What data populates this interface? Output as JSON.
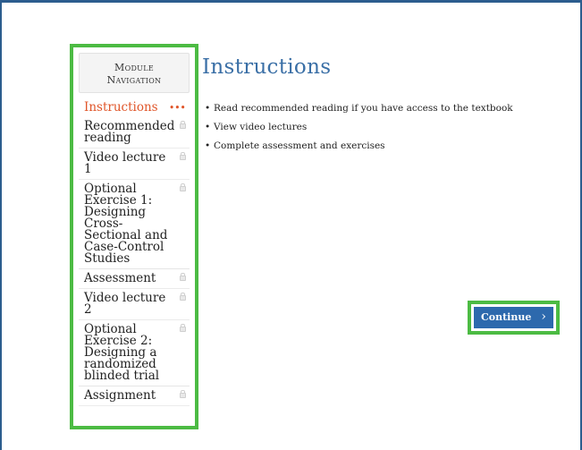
{
  "sidebar": {
    "header_line1": "Module",
    "header_line2": "Navigation",
    "items": [
      {
        "label": "Instructions",
        "active": true,
        "status": "•••"
      },
      {
        "label": "Recommended reading"
      },
      {
        "label": "Video lecture 1"
      },
      {
        "label": "Optional Exercise 1: Designing Cross-Sectional and Case-Control Studies"
      },
      {
        "label": "Assessment"
      },
      {
        "label": "Video lecture 2"
      },
      {
        "label": "Optional Exercise 2: Designing a randomized blinded trial"
      },
      {
        "label": "Assignment"
      }
    ]
  },
  "main": {
    "title": "Instructions",
    "bullets": [
      "Read recommended reading if you have access to the textbook",
      "View video lectures",
      "Complete assessment and exercises"
    ],
    "continue_label": "Continue",
    "continue_icon": "chevron-right-icon"
  },
  "colors": {
    "frame": "#2c5d8e",
    "highlight": "#4cbb43",
    "title": "#3a6fa6",
    "active_item": "#e0562a",
    "button": "#2d69ad"
  }
}
